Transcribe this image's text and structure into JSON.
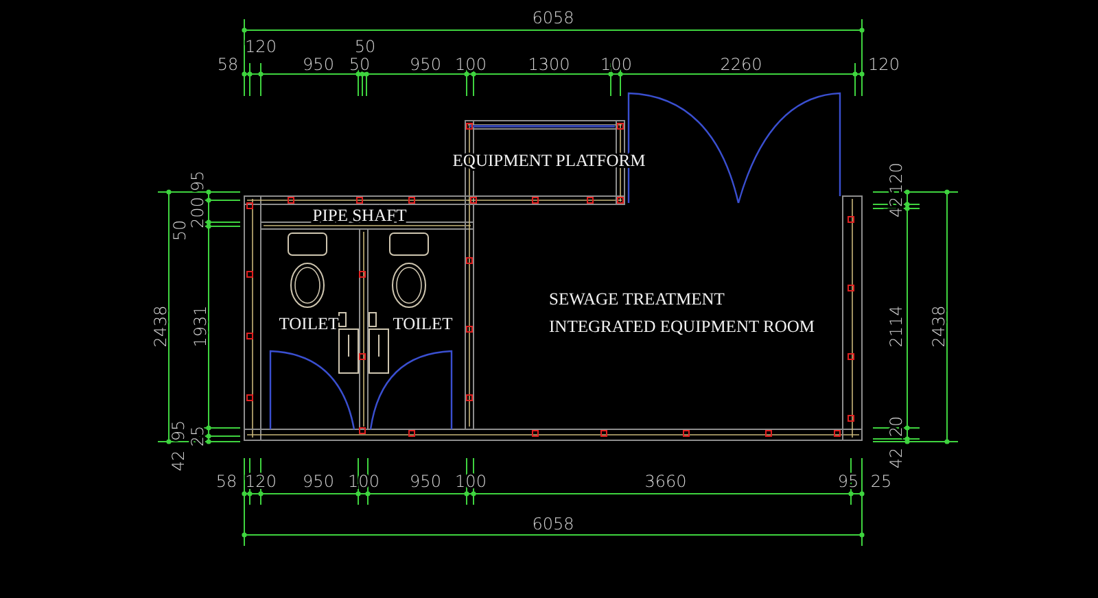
{
  "dimensions": {
    "top": {
      "overall": "6058",
      "segments": [
        "120",
        "50",
        "58",
        "950",
        "50",
        "950",
        "100",
        "1300",
        "100",
        "2260",
        "120"
      ]
    },
    "bottom": {
      "overall": "6058",
      "segments": [
        "58",
        "120",
        "950",
        "100",
        "950",
        "100",
        "3660",
        "95",
        "25"
      ]
    },
    "left": {
      "overall": "2438",
      "segments": [
        "95",
        "200",
        "50",
        "1931",
        "95",
        "25",
        "42"
      ]
    },
    "right": {
      "overall": "2438",
      "segments": [
        "120",
        "42",
        "2114",
        "20",
        "42"
      ]
    }
  },
  "rooms": [
    {
      "label": "EQUIPMENT PLATFORM"
    },
    {
      "label": "PIPE SHAFT"
    },
    {
      "label": "TOILET"
    },
    {
      "label": "TOILET"
    },
    {
      "label": "SEWAGE TREATMENT"
    },
    {
      "label": "INTEGRATED EQUIPMENT ROOM"
    }
  ]
}
